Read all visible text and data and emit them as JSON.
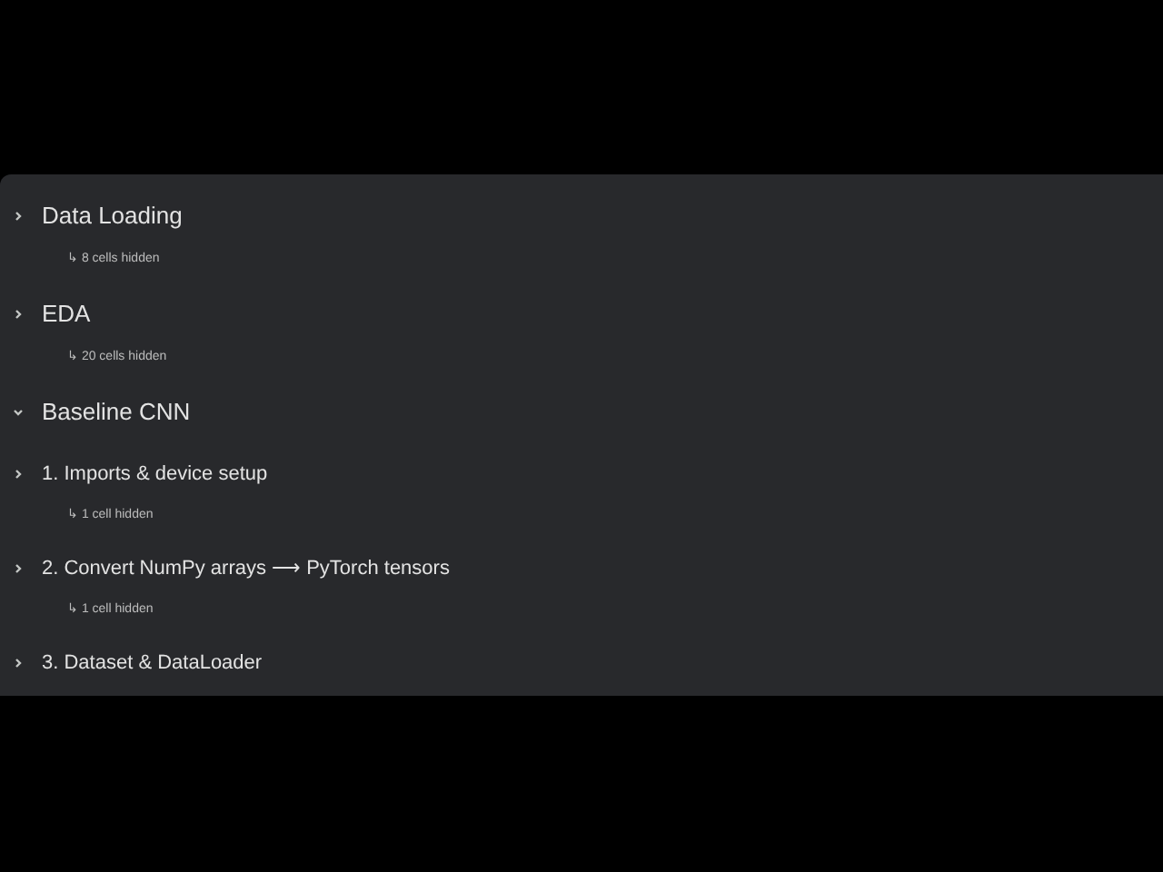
{
  "sections": [
    {
      "title": "Data Loading",
      "expanded": false,
      "hidden_note": "↳ 8 cells hidden"
    },
    {
      "title": "EDA",
      "expanded": false,
      "hidden_note": "↳ 20 cells hidden"
    },
    {
      "title": "Baseline CNN",
      "expanded": true,
      "children": [
        {
          "title": "1. Imports & device setup",
          "expanded": false,
          "hidden_note": "↳ 1 cell hidden"
        },
        {
          "title": "2. Convert NumPy arrays ⟶ PyTorch tensors",
          "expanded": false,
          "hidden_note": "↳ 1 cell hidden"
        },
        {
          "title": "3. Dataset & DataLoader",
          "expanded": false
        }
      ]
    }
  ]
}
